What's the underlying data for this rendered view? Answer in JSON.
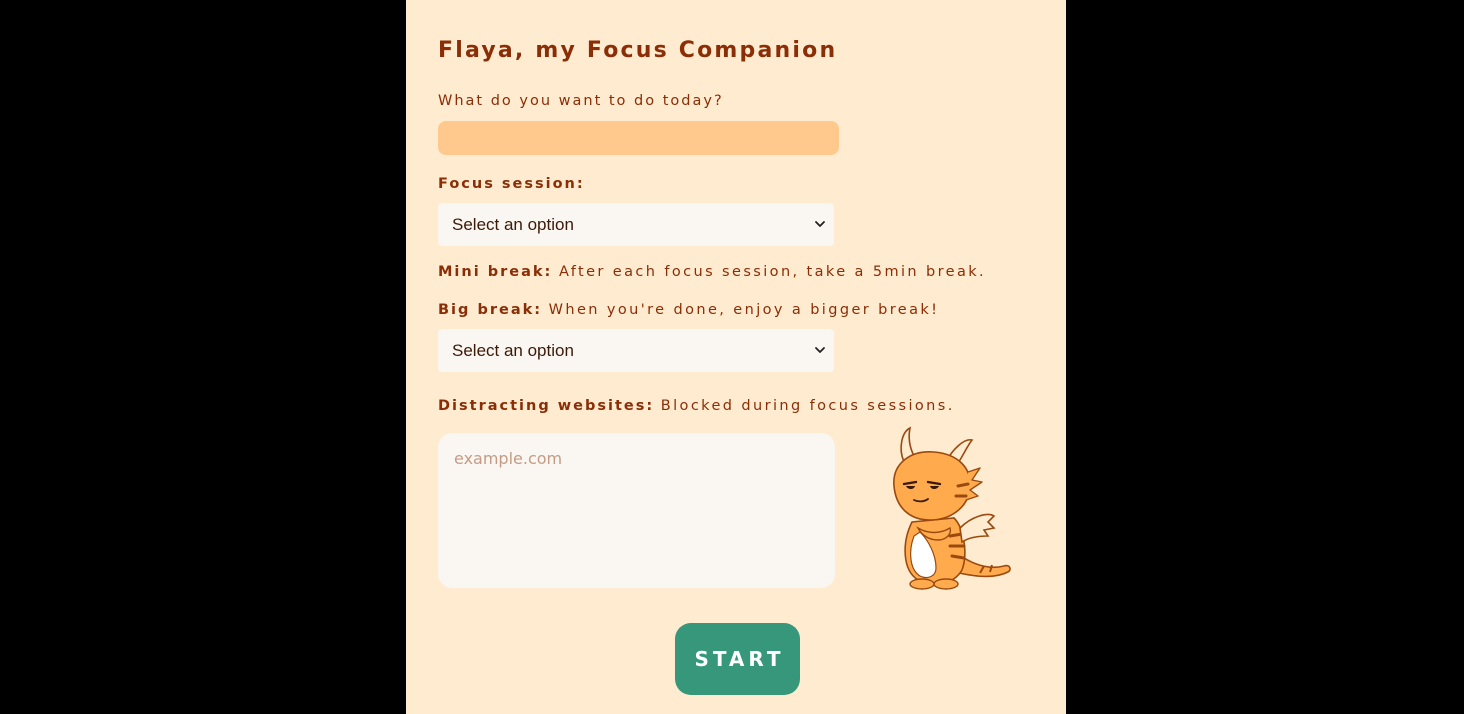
{
  "app": {
    "title": "Flaya, my Focus Companion"
  },
  "task": {
    "label": "What do you want to do today?",
    "value": ""
  },
  "focus_session": {
    "label": "Focus session:",
    "selected": "Select an option"
  },
  "mini_break": {
    "label": "Mini break:",
    "description": "After each focus session, take a 5min break."
  },
  "big_break": {
    "label": "Big break:",
    "description": "When you're done, enjoy a bigger break!",
    "selected": "Select an option"
  },
  "websites": {
    "label": "Distracting websites:",
    "description": "Blocked during focus sessions.",
    "placeholder": "example.com"
  },
  "start_button": {
    "label": "START"
  },
  "icons": {
    "dropdown": "chevron-down-icon",
    "mascot": "dragon-mascot"
  },
  "colors": {
    "background": "#000000",
    "panel": "#ffebcf",
    "text": "#8a2e07",
    "task_input": "#ffc98e",
    "field": "#faf6f2",
    "button": "#36977b",
    "dragon": "#ffab4d"
  }
}
